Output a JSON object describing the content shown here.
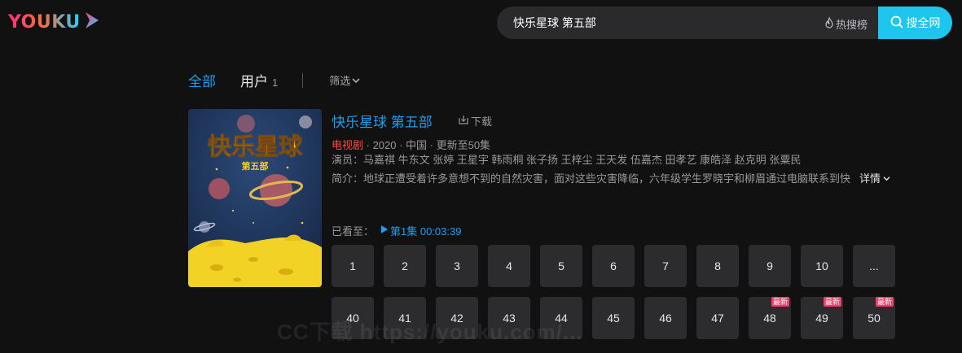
{
  "header": {
    "logo_text": "YOUKU",
    "search_value": "快乐星球 第五部",
    "hot_label": "热搜榜",
    "search_button_label": "搜全网",
    "brand_color": "#1ec6ee"
  },
  "tabs": {
    "all_label": "全部",
    "user_label": "用户",
    "user_count": "1",
    "filter_label": "筛选"
  },
  "result": {
    "poster_title": "快乐星球",
    "poster_subtitle": "第五部",
    "title": "快乐星球 第五部",
    "download_label": "下载",
    "genre": "电视剧",
    "meta_rest": " · 2020 · 中国 · 更新至50集",
    "cast": "演员：马嘉祺 牛东文 张婷 王星宇 韩雨桐 张子扬 王梓尘 王天发 伍嘉杰 田孝艺 康皓泽 赵克明 张粟民",
    "description": "简介：地球正遭受着许多意想不到的自然灾害，面对这些灾害降临，六年级学生罗晓宇和柳眉通过电脑联系到快",
    "detail_label": "详情",
    "watched_label": "已看至：",
    "watched_progress": "第1集 00:03:39"
  },
  "episodes": [
    {
      "label": "1",
      "badge": ""
    },
    {
      "label": "2",
      "badge": ""
    },
    {
      "label": "3",
      "badge": ""
    },
    {
      "label": "4",
      "badge": ""
    },
    {
      "label": "5",
      "badge": ""
    },
    {
      "label": "6",
      "badge": ""
    },
    {
      "label": "7",
      "badge": ""
    },
    {
      "label": "8",
      "badge": ""
    },
    {
      "label": "9",
      "badge": ""
    },
    {
      "label": "10",
      "badge": ""
    },
    {
      "label": "...",
      "badge": ""
    },
    {
      "label": "40",
      "badge": ""
    },
    {
      "label": "41",
      "badge": ""
    },
    {
      "label": "42",
      "badge": ""
    },
    {
      "label": "43",
      "badge": ""
    },
    {
      "label": "44",
      "badge": ""
    },
    {
      "label": "45",
      "badge": ""
    },
    {
      "label": "46",
      "badge": ""
    },
    {
      "label": "47",
      "badge": ""
    },
    {
      "label": "48",
      "badge": "最新"
    },
    {
      "label": "49",
      "badge": "最新"
    },
    {
      "label": "50",
      "badge": "最新"
    }
  ],
  "watermark": "CC下载 https://youku.com/..."
}
